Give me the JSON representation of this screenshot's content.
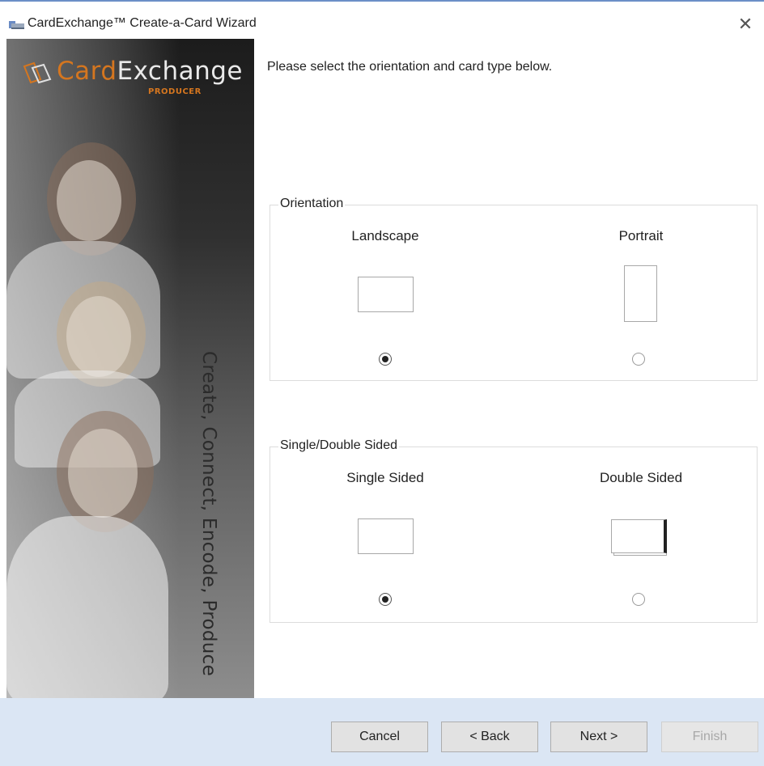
{
  "window": {
    "title": "CardExchange™ Create-a-Card Wizard",
    "close_glyph": "✕"
  },
  "sidebar": {
    "logo_card": "Card",
    "logo_exchange": "Exchange",
    "logo_sub": "PRODUCER",
    "tagline": "Create, Connect, Encode, Produce"
  },
  "instruction": "Please select the orientation and card type below.",
  "orientation": {
    "title": "Orientation",
    "options": [
      {
        "label": "Landscape",
        "checked": true
      },
      {
        "label": "Portrait",
        "checked": false
      }
    ]
  },
  "sides": {
    "title": "Single/Double Sided",
    "options": [
      {
        "label": "Single Sided",
        "checked": true
      },
      {
        "label": "Double Sided",
        "checked": false
      }
    ]
  },
  "buttons": {
    "cancel": "Cancel",
    "back": "< Back",
    "next": "Next >",
    "finish": "Finish"
  },
  "colors": {
    "brand_orange": "#d5761f",
    "footer_bg": "#dbe6f4"
  }
}
